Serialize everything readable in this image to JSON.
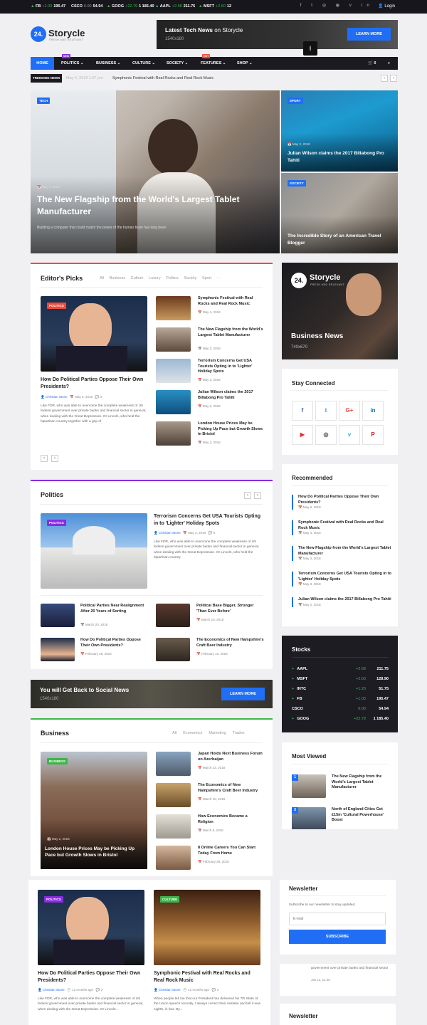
{
  "topbar": {
    "tickers": [
      {
        "sym": "FB",
        "chg": "+1.03",
        "price": "195.47"
      },
      {
        "sym": "CSCO",
        "chg": "0.00",
        "price": "54.94"
      },
      {
        "sym": "GOOG",
        "chg": "+22.79",
        "price": "1 185.40"
      },
      {
        "sym": "AAPL",
        "chg": "+2.68",
        "price": "211.75"
      },
      {
        "sym": "MSFT",
        "chg": "+2.60",
        "price": "12"
      }
    ],
    "social_icons": "f t ◎ ◉ v in",
    "login": "Login"
  },
  "logo": {
    "badge": "24.",
    "name": "Storycle",
    "tagline": "FRESH AND RELEVANT"
  },
  "ad_top": {
    "title_bold": "Latest Tech News",
    "title_rest": " on Storycle",
    "size": "1540x180",
    "button": "LEARN MORE"
  },
  "nav": {
    "items": [
      "HOME",
      "POLITICS",
      "BUSINESS",
      "CULTURE",
      "SOCIETY",
      "FEATURES",
      "SHOP"
    ],
    "badges": {
      "politics": "NEW",
      "features": "HOT"
    },
    "cart_count": "0"
  },
  "trending": {
    "label": "TRENDING NEWS",
    "date": "May 4, 2018 1:37 pm",
    "headline": "Symphonic Festival with Real Rocks and Real Rock Music"
  },
  "hero": {
    "main": {
      "tag": "TECH",
      "date": "May 3, 2018",
      "title": "The New Flagship from the World's Largest Tablet Manufacturer",
      "excerpt": "Building a computer that could match the power of the human brain has long been"
    },
    "side1": {
      "tag": "SPORT",
      "date": "May 2, 2018",
      "title": "Julian Wilson claims the 2017 Billabong Pro Tahiti"
    },
    "side2": {
      "tag": "SOCIETY",
      "title": "The Incredible Story of an American Travel Blogger"
    }
  },
  "editors": {
    "title": "Editor's Picks",
    "filters": [
      "All",
      "Business",
      "Culture",
      "Luxury",
      "Politics",
      "Society",
      "Sport"
    ],
    "featured": {
      "tag": "POLITICS",
      "title": "How Do Political Parties Oppose Their Own Presidents?",
      "author": "Christian Stone",
      "date": "May 6, 2018",
      "comments": "3",
      "excerpt": "Like FDR, who was able to overcome the complete weakness of US federal government over private banks and financial sector in general, when dealing with the Great Depression. Or Lincoln, who held the bipartisan country together with a grip of"
    },
    "list": [
      {
        "title": "Symphonic Festival with Real Rocks and Real Rock Music",
        "date": "May 4, 2018"
      },
      {
        "title": "The New Flagship from the World's Largest Tablet Manufacturer",
        "date": "May 3, 2018"
      },
      {
        "title": "Terrorism Concerns Get USA Tourists Opting in to 'Lighter' Holiday Spots",
        "date": "May 3, 2018"
      },
      {
        "title": "Julian Wilson claims the 2017 Billabong Pro Tahiti",
        "date": "May 2, 2018"
      },
      {
        "title": "London House Prices May be Picking Up Pace but Growth Slows in Bristol",
        "date": "May 2, 2018"
      }
    ]
  },
  "politics": {
    "title": "Politics",
    "featured": {
      "tag": "POLITICS",
      "title": "Terrorism Concerns Get USA Tourists Opting in to 'Lighter' Holiday Spots",
      "author": "Christian Stone",
      "date": "May 3, 2018",
      "comments": "0",
      "excerpt": "Like FDR, who was able to overcome the complete weakness of US federal government over private banks and financial sector in general, when dealing with the Great Depression. Or Lincoln, who held the bipartisan country"
    },
    "grid": [
      {
        "title": "Political Parties Near Realignment After 20 Years of Sorting",
        "date": "March 20, 2018"
      },
      {
        "title": "Political Base Bigger, Stronger 'Than Ever Before'",
        "date": "March 10, 2018"
      },
      {
        "title": "How Do Political Parties Oppose Their Own Presidents?",
        "date": "February 25, 2018"
      },
      {
        "title": "The Economics of New Hampshire's Craft Beer Industry",
        "date": "February 10, 2018"
      }
    ]
  },
  "ad_mid": {
    "title": "You will Get Back to Social News",
    "size": "1540x180",
    "button": "LEARN MORE"
  },
  "business": {
    "title": "Business",
    "filters": [
      "All",
      "Economics",
      "Marketing",
      "Trades"
    ],
    "featured": {
      "tag": "BUSINESS",
      "date": "May 2, 2018",
      "title": "London House Prices May be Picking Up Pace but Growth Slows in Bristol"
    },
    "list": [
      {
        "title": "Japan Holds Next Business Forum on Azerbaijan",
        "date": "March 23, 2018"
      },
      {
        "title": "The Economics of New Hampshire's Craft Beer Industry",
        "date": "March 10, 2018"
      },
      {
        "title": "How Economics Became a Religion",
        "date": "March 8, 2018"
      },
      {
        "title": "8 Online Careers You Can Start Today From Home",
        "date": "February 28, 2018"
      }
    ]
  },
  "bottom": {
    "left": {
      "tag": "POLITICS",
      "title": "How Do Political Parties Oppose Their Own Presidents?",
      "author": "Christian Stone",
      "date": "12 months ago",
      "comments": "3",
      "excerpt": "Like FDR, who was able to overcome the complete weakness of US federal government over private banks and financial sector in general, when dealing with the Great Depression. Or Lincoln..."
    },
    "right": {
      "tag": "CULTURE",
      "title": "Symphonic Festival with Real Rocks and Real Rock Music",
      "author": "Christian Stone",
      "date": "12 months ago",
      "comments": "3",
      "excerpt": "When people tell me that our President has delivered his 7th State of the Union speech recently, I always correct their mistake and tell it was eighth, in fact. By..."
    }
  },
  "sidebar": {
    "ad": {
      "badge": "24.",
      "name": "Storycle",
      "tagline": "FRESH AND RELEVANT",
      "title": "Business News",
      "size": "740x670"
    },
    "stay_connected": {
      "title": "Stay Connected",
      "icons": [
        "f",
        "t",
        "G+",
        "in",
        "▶",
        "◎",
        "v",
        "P"
      ]
    },
    "recommended": {
      "title": "Recommended",
      "items": [
        {
          "title": "How Do Political Parties Oppose Their Own Presidents?",
          "date": "May 6, 2018"
        },
        {
          "title": "Symphonic Festival with Real Rocks and Real Rock Music",
          "date": "May 4, 2018"
        },
        {
          "title": "The New Flagship from the World's Largest Tablet Manufacturer",
          "date": "May 3, 2018"
        },
        {
          "title": "Terrorism Concerns Get USA Tourists Opting in to 'Lighter' Holiday Spots",
          "date": "May 3, 2018"
        },
        {
          "title": "Julian Wilson claims the 2017 Billabong Pro Tahiti",
          "date": "May 2, 2018"
        }
      ]
    },
    "stocks": {
      "title": "Stocks",
      "rows": [
        {
          "sym": "AAPL",
          "chg": "+2.68",
          "price": "211.75"
        },
        {
          "sym": "MSFT",
          "chg": "+2.60",
          "price": "128.90"
        },
        {
          "sym": "INTC",
          "chg": "+1.20",
          "price": "51.75"
        },
        {
          "sym": "FB",
          "chg": "+1.03",
          "price": "195.47"
        },
        {
          "sym": "CSCO",
          "chg": "0.00",
          "price": "54.94"
        },
        {
          "sym": "GOOG",
          "chg": "+22.79",
          "price": "1 185.40"
        }
      ]
    },
    "most_viewed": {
      "title": "Most Viewed",
      "items": [
        {
          "num": "1",
          "title": "The New Flagship from the World's Largest Tablet Manufacturer"
        },
        {
          "num": "3",
          "title": "North of England Cities Get £15m 'Cultural Powerhouse' Boost"
        }
      ]
    },
    "newsletter": {
      "title": "Newsletter",
      "text": "Subscribe to our newsletter to stay updated.",
      "placeholder": "E-mail",
      "button": "SUBSCRIBE"
    },
    "snippet": {
      "text": "government over private banks and financial sector",
      "date": "Jan 11, 11:46"
    },
    "newsletter2": {
      "title": "Newsletter"
    }
  }
}
